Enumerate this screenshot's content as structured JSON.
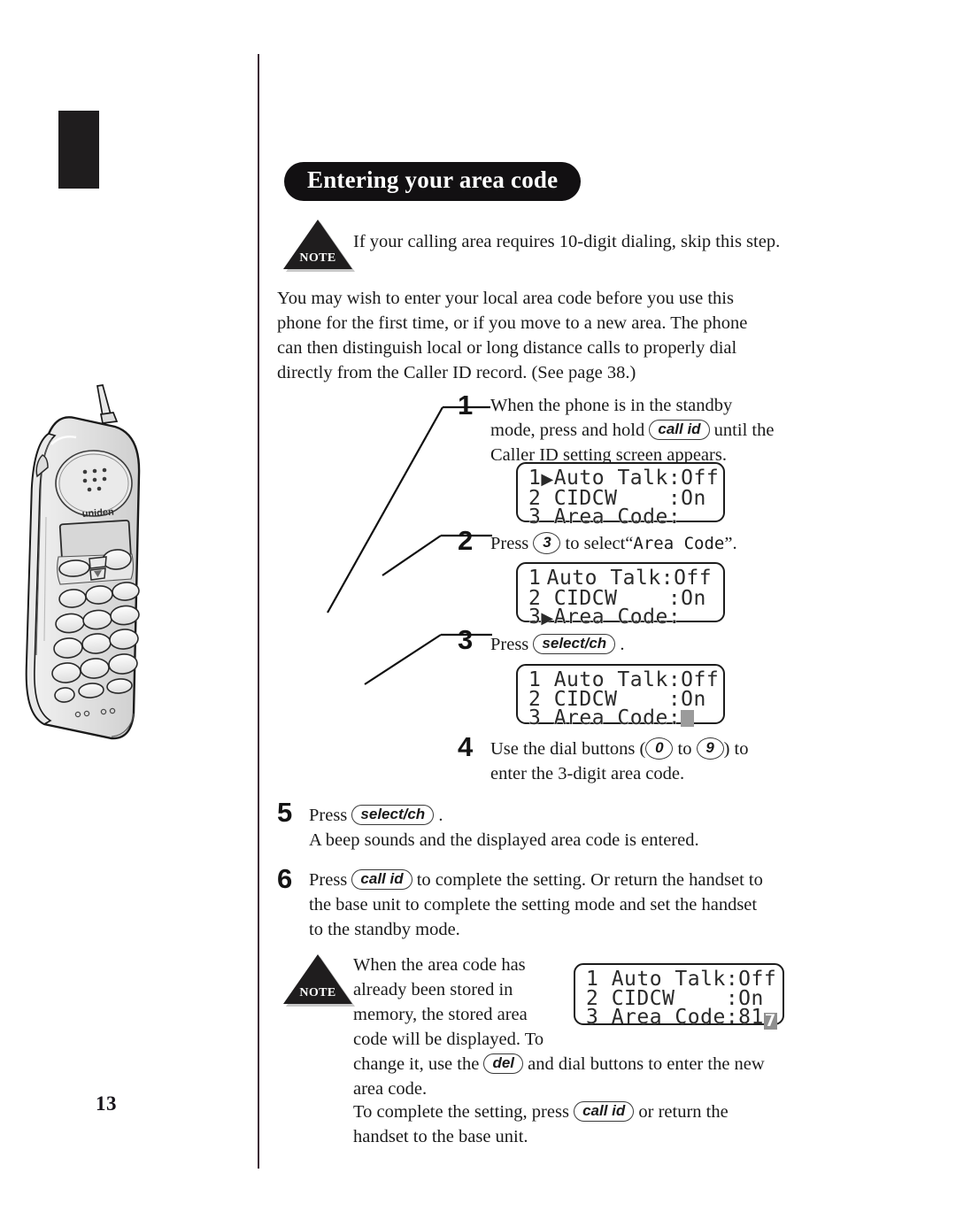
{
  "page": {
    "number": "13",
    "title": "Entering your area code"
  },
  "notes": {
    "badge_label": "NOTE",
    "top_note_text": "If your calling area requires 10-digit dialing, skip this step.",
    "bottom_note_line1": "When the area code has",
    "bottom_note_line2": "already been stored in",
    "bottom_note_line3": "memory, the stored area",
    "bottom_note_line4": "code will be displayed. To",
    "bottom_note_line5_a": "change it, use the",
    "bottom_note_key": "del",
    "bottom_note_line5_b": "and dial buttons to enter the new",
    "bottom_note_line6": "area code.",
    "bottom_note_line7_a": "To complete the setting, press",
    "bottom_note_key2": "call id",
    "bottom_note_line7_b": "or return the",
    "bottom_note_line8": "handset to the base unit."
  },
  "intro": {
    "line1": "You may wish to enter your local area code before you use this",
    "line2": "phone for the first time, or if you move to a new area. The phone",
    "line3": "can then distinguish local or long distance calls to properly dial",
    "line4": "directly from the Caller ID record. (See page 38.)"
  },
  "steps": [
    {
      "number": "1",
      "line1": "When the phone is in the standby",
      "line2_a": "mode, press and hold",
      "key": "call id",
      "line2_b": "until the",
      "line3": "Caller ID setting screen appears."
    },
    {
      "number": "2",
      "press_label": "Press",
      "key": "3",
      "middle": "to select",
      "quoted_open": "“",
      "quoted_lcd": "Area Code",
      "quoted_close": "”."
    },
    {
      "number": "3",
      "press_label": "Press",
      "key": "select/ch",
      "period": "."
    },
    {
      "number": "4",
      "line1_a": "Use the dial buttons (",
      "key_low": "0",
      "line1_b": "to",
      "key_high": "9",
      "line1_c": ") to",
      "line2": "enter the 3-digit area code."
    },
    {
      "number": "5",
      "press_label": "Press",
      "key": "select/ch",
      "period": ".",
      "line2": "A beep sounds and the displayed area code is entered."
    },
    {
      "number": "6",
      "press_label": "Press",
      "key": "call id",
      "line1_b": "to complete the setting. Or return the handset to",
      "line2": "the base unit to complete the setting mode and set the handset",
      "line3": "to the standby mode."
    }
  ],
  "lcd_screens": [
    {
      "id": "lcd-step1",
      "line1_num": "1",
      "line1_marker": "▶",
      "line1_text": "Auto Talk:Off",
      "line2": "2 CIDCW    :On",
      "line3": "3 Area Code:",
      "cursor": "none"
    },
    {
      "id": "lcd-step2",
      "line1_num": "1",
      "line1_marker": " ",
      "line1_text": "Auto Talk:Off",
      "line2": "2 CIDCW    :On",
      "line3_num": "3",
      "line3_marker": "▶",
      "line3_text": "Area Code:",
      "cursor": "none"
    },
    {
      "id": "lcd-step3",
      "line1": "1 Auto Talk:Off",
      "line2": "2 CIDCW    :On",
      "line3": "3 Area Code:",
      "cursor": "block"
    },
    {
      "id": "lcd-note",
      "line1": "1 Auto Talk:Off",
      "line2": "2 CIDCW    :On",
      "line3": "3 Area Code:81",
      "cursor_char": "7"
    }
  ],
  "phone": {
    "brand": "uniden",
    "callout_1": "1",
    "callout_2": "2",
    "callout_3": "3"
  },
  "colors": {
    "ink": "#1a1a1a",
    "pill_bg": "#121012",
    "rule": "#3a2434",
    "cursor_gray": "#9b9b9b"
  }
}
